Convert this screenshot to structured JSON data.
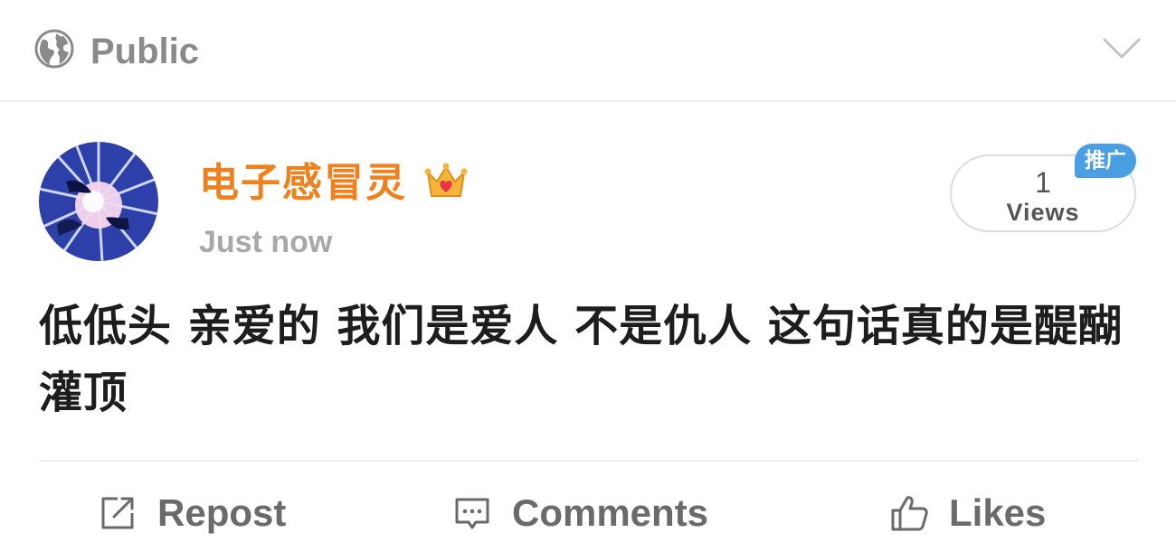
{
  "visibility": {
    "label": "Public",
    "icon": "globe-icon"
  },
  "expand": {
    "icon": "chevron-down-icon"
  },
  "post": {
    "author": {
      "name": "电子感冒灵",
      "badge_icon": "crown-icon",
      "avatar": "avatar-image"
    },
    "timestamp": "Just now",
    "views": {
      "count": "1",
      "label": "Views"
    },
    "promo_badge": "推广",
    "text": "低低头 亲爱的 我们是爱人 不是仇人 这句话真的是醍醐灌顶"
  },
  "actions": {
    "repost": {
      "label": "Repost",
      "icon": "repost-icon"
    },
    "comments": {
      "label": "Comments",
      "icon": "comment-icon"
    },
    "likes": {
      "label": "Likes",
      "icon": "thumbs-up-icon"
    }
  },
  "colors": {
    "username": "#f0801c",
    "promo_badge": "#4a9fe3",
    "muted_text": "#8a8a8a",
    "body_text": "#1d1d1d"
  }
}
